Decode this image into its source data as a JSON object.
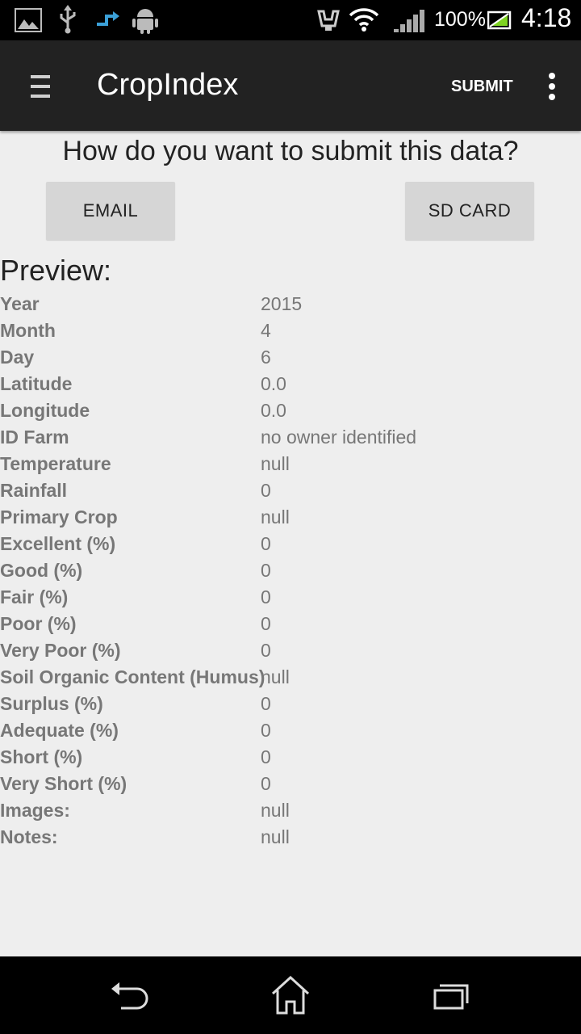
{
  "status_bar": {
    "battery": "100%",
    "time": "4:18",
    "icons": [
      "image-icon",
      "usb-icon",
      "sync-icon",
      "android-icon",
      "vibrate-icon",
      "wifi-icon",
      "signal-icon",
      "battery-charging-icon"
    ]
  },
  "action_bar": {
    "title": "CropIndex",
    "submit_label": "SUBMIT",
    "drawer_icon": "drawer-menu-icon",
    "overflow_icon": "overflow-menu-icon"
  },
  "content": {
    "question": "How do you want to submit this data?",
    "email_label": "EMAIL",
    "sdcard_label": "SD CARD",
    "preview_title": "Preview:"
  },
  "preview": [
    {
      "key": "Year",
      "value": "2015"
    },
    {
      "key": "Month",
      "value": "4"
    },
    {
      "key": "Day",
      "value": "6"
    },
    {
      "key": "Latitude",
      "value": "0.0"
    },
    {
      "key": "Longitude",
      "value": "0.0"
    },
    {
      "key": "ID Farm",
      "value": "no owner identified"
    },
    {
      "key": "Temperature",
      "value": "null"
    },
    {
      "key": "Rainfall",
      "value": "0"
    },
    {
      "key": "Primary Crop",
      "value": "null"
    },
    {
      "key": "Excellent (%)",
      "value": "0"
    },
    {
      "key": "Good (%)",
      "value": "0"
    },
    {
      "key": "Fair (%)",
      "value": "0"
    },
    {
      "key": "Poor (%)",
      "value": "0"
    },
    {
      "key": "Very Poor (%)",
      "value": "0"
    },
    {
      "key": "Soil Organic Content (Humus)",
      "value": "null"
    },
    {
      "key": "Surplus (%)",
      "value": "0"
    },
    {
      "key": "Adequate (%)",
      "value": "0"
    },
    {
      "key": "Short (%)",
      "value": "0"
    },
    {
      "key": "Very Short (%)",
      "value": "0"
    },
    {
      "key": "Images:",
      "value": "null"
    },
    {
      "key": "Notes:",
      "value": "null"
    }
  ],
  "nav_bar": {
    "icons": [
      "back-icon",
      "home-icon",
      "recent-apps-icon"
    ]
  },
  "colors": {
    "status_bar": "#000000",
    "action_bar": "#222222",
    "background": "#eeeeee",
    "button": "#d6d6d6",
    "label_text": "#777777",
    "navigation_bar": "#000000"
  }
}
